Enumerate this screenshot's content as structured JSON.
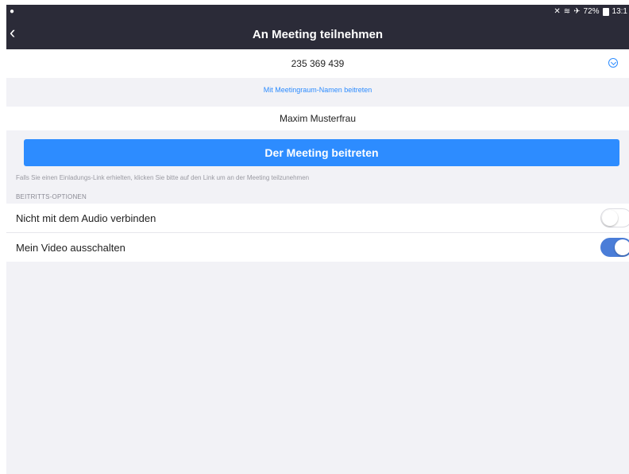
{
  "status_bar": {
    "left_icon": "app-indicator-icon",
    "right_icons": [
      "mute-icon",
      "wifi-icon",
      "airplane-icon"
    ],
    "battery": "72%",
    "time": "13:1"
  },
  "nav": {
    "back_icon": "chevron-left-icon",
    "title": "An Meeting teilnehmen"
  },
  "meeting_id": {
    "value": "235 369 439",
    "dropdown_icon": "chevron-down-circle-icon"
  },
  "room_link": {
    "label": "Mit Meetingraum-Namen beitreten"
  },
  "name_field": {
    "value": "Maxim Musterfrau"
  },
  "join_button": {
    "label": "Der Meeting beitreten"
  },
  "hint": "Falls Sie einen Einladungs-Link erhielten, klicken Sie bitte auf den Link um an der Meeting teilzunehmen",
  "options": {
    "section_title": "BEITRITTS-OPTIONEN",
    "items": [
      {
        "label": "Nicht mit dem Audio verbinden",
        "enabled": false
      },
      {
        "label": "Mein Video ausschalten",
        "enabled": true
      }
    ]
  },
  "colors": {
    "accent": "#2d8cff",
    "nav_background": "#2b2b38",
    "toggle_on": "#4a7dd8",
    "page_background": "#f2f2f6"
  }
}
